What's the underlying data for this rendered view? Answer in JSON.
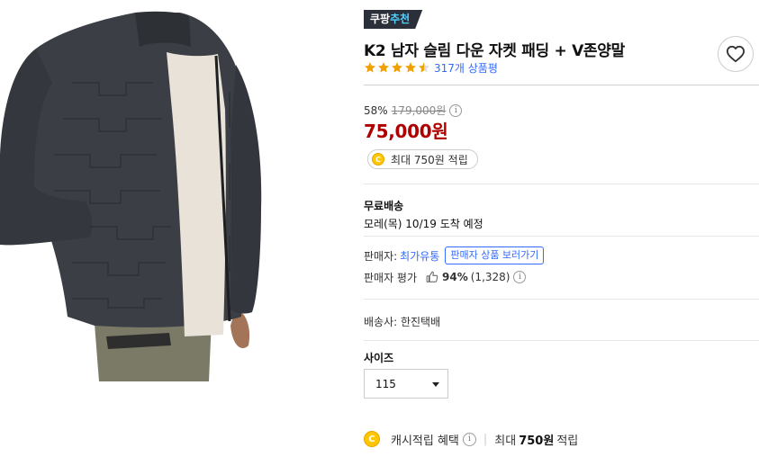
{
  "badge": {
    "prefix": "쿠팡",
    "accent": "추천"
  },
  "product": {
    "title": "K2 남자 슬림 다운 자켓 패딩 + V존양말",
    "rating": 4.5,
    "review_count": "317개 상품평"
  },
  "price": {
    "discount_rate": "58%",
    "original": "179,000원",
    "sale": "75,000원",
    "info_icon": "i"
  },
  "reward": {
    "coin_label": "C",
    "text": "최대 750원 적립"
  },
  "shipping": {
    "label": "무료배송",
    "date": "모레(목) 10/19 도착 예정"
  },
  "seller": {
    "label": "판매자:",
    "name": "최가유통",
    "link_label": "판매자 상품 보러가기",
    "eval_label": "판매자 평가",
    "eval_pct": "94%",
    "eval_count": "(1,328)"
  },
  "courier": "배송사: 한진택배",
  "size": {
    "label": "사이즈",
    "selected": "115"
  },
  "cash": {
    "label": "캐시적립 혜택",
    "separator": "|",
    "prefix": "최대",
    "amount": "750원",
    "suffix": "적립"
  },
  "colors": {
    "accent_blue": "#346aff",
    "sale_red": "#ae0000",
    "star": "#f0a000",
    "coin": "#ffc700",
    "badge_bg": "#2a2f3a"
  },
  "icons": [
    "star-icon",
    "heart-icon",
    "info-icon",
    "coin-icon",
    "thumbs-up-icon",
    "caret-down-icon"
  ]
}
